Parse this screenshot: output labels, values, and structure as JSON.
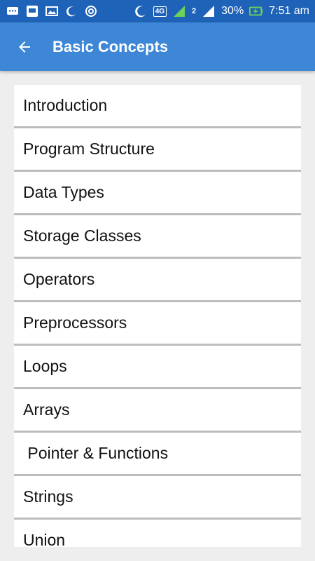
{
  "status_bar": {
    "battery": "30%",
    "time": "7:51 am",
    "network": "4G",
    "sim2": "2",
    "icons": [
      "chat-icon",
      "image-icon",
      "gallery-icon",
      "moon-icon",
      "hotspot-icon",
      "moon-icon",
      "signal-icon",
      "signal-icon",
      "battery-charging-icon"
    ]
  },
  "app_bar": {
    "title": "Basic Concepts",
    "back_icon": "arrow-left-icon",
    "color": "#3d87d6"
  },
  "list": {
    "items": [
      "Introduction",
      "Program Structure",
      "Data Types",
      "Storage Classes",
      "Operators",
      "Preprocessors",
      "Loops",
      "Arrays",
      " Pointer & Functions",
      "Strings",
      "Union"
    ]
  }
}
